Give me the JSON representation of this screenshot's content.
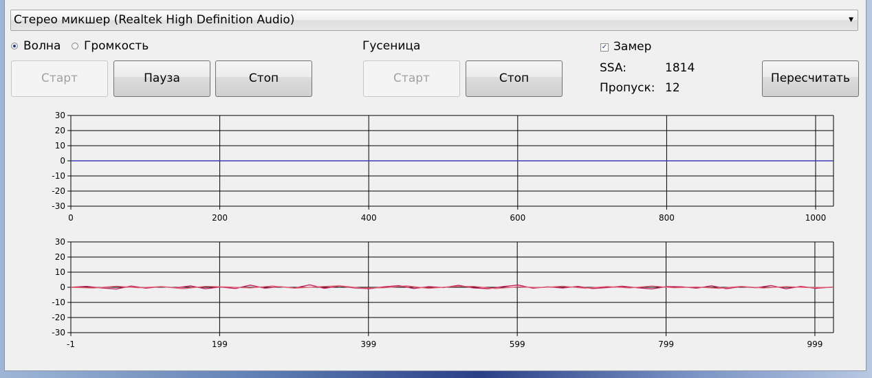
{
  "device": {
    "selected": "Стерео микшер (Realtek High Definition Audio)"
  },
  "mode": {
    "wave_label": "Волна",
    "volume_label": "Громкость",
    "selected": "wave"
  },
  "buttons": {
    "start": "Старт",
    "pause": "Пауза",
    "stop": "Стоп"
  },
  "caterpillar": {
    "title": "Гусеница",
    "start": "Старт",
    "stop": "Стоп"
  },
  "measure": {
    "checkbox_label": "Замер",
    "checked": true,
    "ssa_label": "SSA:",
    "ssa_value": "1814",
    "skip_label": "Пропуск:",
    "skip_value": "12",
    "recalc_button": "Пересчитать"
  },
  "chart_data": [
    {
      "type": "line",
      "ylim": [
        -30,
        30
      ],
      "xlim": [
        0,
        1024
      ],
      "y_ticks": [
        "30",
        "20",
        "10",
        "0",
        "-10",
        "-20",
        "-30"
      ],
      "x_ticks": [
        "0",
        "200",
        "400",
        "600",
        "800",
        "1000"
      ],
      "grid": true,
      "series": [
        {
          "color": "#3a3ab8",
          "x": [
            0,
            50,
            100,
            150,
            200,
            250,
            300,
            350,
            400,
            450,
            500,
            550,
            600,
            650,
            700,
            750,
            800,
            850,
            900,
            950,
            1000,
            1024
          ],
          "y": [
            0,
            0,
            0,
            0,
            0,
            0,
            0,
            0,
            0,
            0,
            0,
            0,
            0,
            0,
            0,
            0,
            0,
            0,
            0,
            0,
            0,
            0
          ]
        }
      ]
    },
    {
      "type": "line",
      "ylim": [
        -30,
        30
      ],
      "xlim": [
        -1,
        1024
      ],
      "y_ticks": [
        "30",
        "20",
        "10",
        "0",
        "-10",
        "-20",
        "-30"
      ],
      "x_ticks": [
        "-1",
        "199",
        "399",
        "599",
        "799",
        "999"
      ],
      "grid": true,
      "series": [
        {
          "color": "#c8205a",
          "x": [
            -1,
            20,
            40,
            60,
            80,
            100,
            120,
            140,
            160,
            180,
            200,
            220,
            240,
            260,
            280,
            300,
            320,
            340,
            360,
            380,
            400,
            420,
            440,
            460,
            480,
            500,
            520,
            540,
            560,
            580,
            600,
            620,
            640,
            660,
            680,
            700,
            720,
            740,
            760,
            780,
            800,
            820,
            840,
            860,
            880,
            900,
            920,
            940,
            960,
            980,
            1000,
            1024
          ],
          "y": [
            0,
            0.6,
            -0.4,
            -1.2,
            0.8,
            -0.6,
            0.5,
            -0.3,
            0.9,
            -1.0,
            0.2,
            -0.8,
            1.4,
            -0.6,
            0.4,
            -0.5,
            1.6,
            -0.7,
            0.8,
            -0.4,
            -0.9,
            0.3,
            1.1,
            -0.8,
            0.4,
            -0.2,
            1.3,
            -0.4,
            -0.9,
            0.5,
            1.5,
            -0.6,
            0.3,
            -0.5,
            0.6,
            -0.8,
            -0.2,
            0.7,
            -0.3,
            -1.1,
            0.5,
            0.3,
            -0.6,
            1.0,
            -0.9,
            0.4,
            -0.3,
            1.2,
            -1.0,
            0.6,
            -0.7,
            0.2
          ]
        },
        {
          "color": "#e06070",
          "x": [
            -1,
            30,
            60,
            90,
            120,
            150,
            180,
            210,
            240,
            270,
            300,
            330,
            360,
            390,
            420,
            450,
            480,
            510,
            540,
            570,
            600,
            630,
            660,
            690,
            720,
            750,
            780,
            810,
            840,
            870,
            900,
            930,
            960,
            990,
            1024
          ],
          "y": [
            0,
            -0.5,
            0.7,
            -0.3,
            0.4,
            -0.9,
            0.6,
            0.2,
            -0.4,
            0.8,
            -0.6,
            0.3,
            1.0,
            -0.5,
            -0.3,
            0.9,
            -0.7,
            0.4,
            0.6,
            -0.8,
            0.3,
            -0.2,
            0.7,
            -0.6,
            0.5,
            -0.4,
            0.8,
            -0.3,
            0.2,
            -0.7,
            0.6,
            -0.5,
            0.4,
            -0.2,
            0
          ]
        }
      ]
    }
  ]
}
